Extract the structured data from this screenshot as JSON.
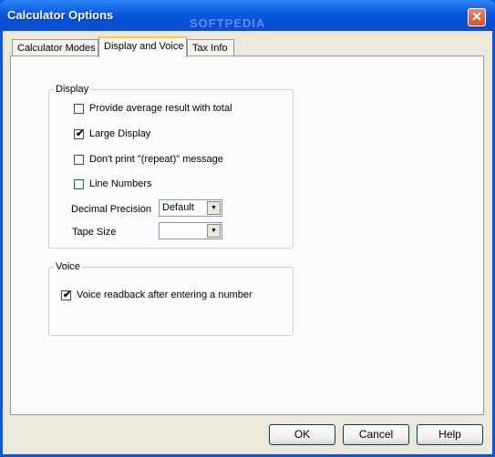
{
  "window": {
    "title": "Calculator Options",
    "watermark": "SOFTPEDIA",
    "close_label": "✕"
  },
  "tabs": [
    {
      "label": "Calculator Modes",
      "active": false
    },
    {
      "label": "Display and Voice",
      "active": true
    },
    {
      "label": "Tax Info",
      "active": false
    }
  ],
  "display": {
    "legend": "Display",
    "options": [
      {
        "label": "Provide average result with total",
        "checked": false
      },
      {
        "label": "Large Display",
        "checked": true
      },
      {
        "label": "Don't print \"(repeat)\" message",
        "checked": false
      },
      {
        "label": "Line Numbers",
        "checked": false
      }
    ],
    "decimal_precision": {
      "label": "Decimal Precision",
      "value": "Default"
    },
    "tape_size": {
      "label": "Tape Size",
      "value": ""
    }
  },
  "voice": {
    "legend": "Voice",
    "options": [
      {
        "label": "Voice readback after entering a number",
        "checked": true
      }
    ]
  },
  "buttons": {
    "ok": "OK",
    "cancel": "Cancel",
    "help": "Help"
  },
  "colors": {
    "title_bar": "#0a55e2",
    "dialog_bg": "#ece9d8",
    "active_tab_highlight": "#ffc83c"
  }
}
